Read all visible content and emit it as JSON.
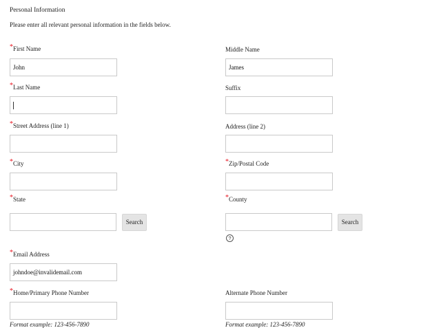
{
  "form": {
    "heading": "Personal Information",
    "instructions": "Please enter all relevant personal information in the fields below.",
    "required_marker": "*",
    "fields": {
      "first_name": {
        "label": "First Name",
        "value": "John"
      },
      "middle_name": {
        "label": "Middle Name",
        "value": "James"
      },
      "last_name": {
        "label": "Last Name",
        "value": ""
      },
      "suffix": {
        "label": "Suffix",
        "value": ""
      },
      "street1": {
        "label": "Street Address (line 1)",
        "value": ""
      },
      "street2": {
        "label": "Address (line 2)",
        "value": ""
      },
      "city": {
        "label": "City",
        "value": ""
      },
      "zip": {
        "label": "Zip/Postal Code",
        "value": ""
      },
      "state": {
        "label": "State",
        "value": ""
      },
      "county": {
        "label": "County",
        "value": ""
      },
      "email": {
        "label": "Email Address",
        "value": "johndoe@invalidemail.com"
      },
      "home_phone": {
        "label": "Home/Primary Phone Number",
        "value": ""
      },
      "alt_phone": {
        "label": "Alternate Phone Number",
        "value": ""
      }
    },
    "search_label": "Search",
    "help_glyph": "?",
    "format_example": "Format example:  123-456-7890"
  },
  "colors": {
    "required": "#e8141f",
    "border": "#c9c9c9",
    "button_bg": "#e4e4e4"
  }
}
